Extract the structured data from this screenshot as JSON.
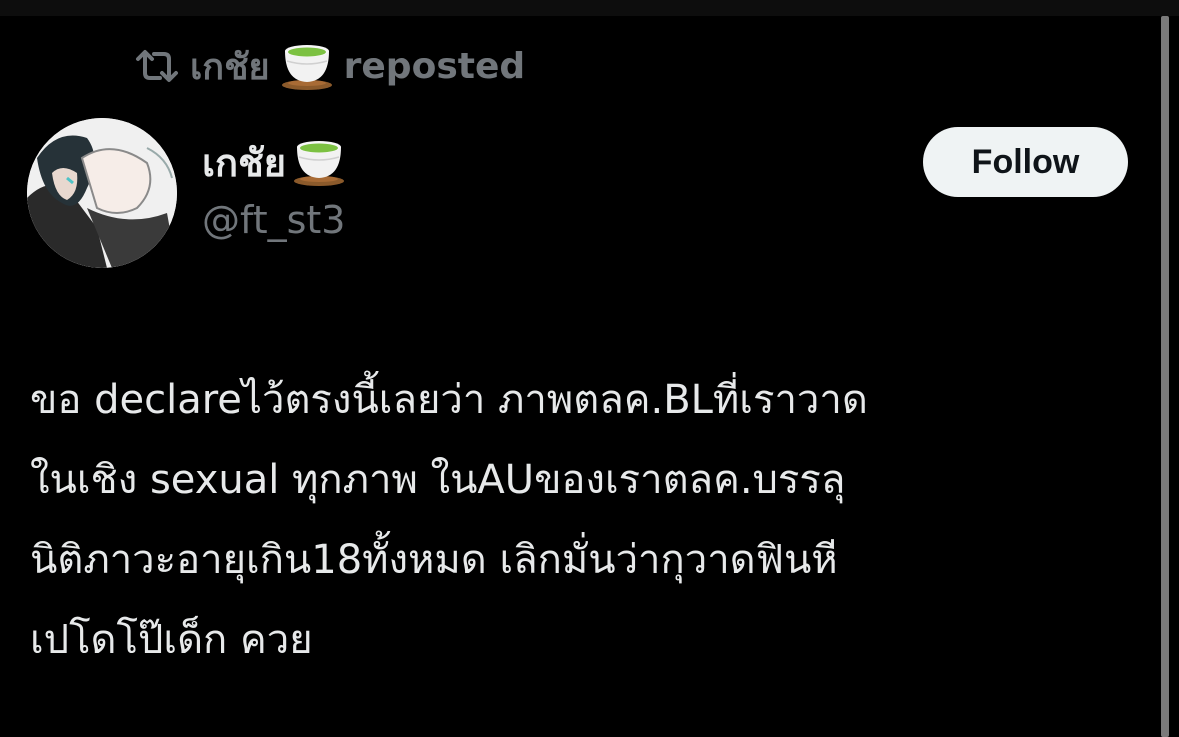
{
  "repost": {
    "icon": "repost-icon",
    "user": "เกชัย",
    "emoji": "🍵",
    "label": "reposted"
  },
  "author": {
    "display_name": "เกชัย",
    "emoji": "🍵",
    "handle": "@ft_st3",
    "avatar": "anime-character-avatar"
  },
  "follow_button": {
    "label": "Follow"
  },
  "tweet": {
    "lines": [
      "ขอ declareไว้ตรงนี้เลยว่า ภาพตลค.BLที่เราวาด",
      "ในเชิง sexual ทุกภาพ ในAUของเราตลค.บรรลุ",
      "นิติภาวะอายุเกิน18ทั้งหมด เลิกมั่นว่ากุวาดฟินหี",
      "เปโดโป๊เด็ก ควย"
    ]
  },
  "colors": {
    "background": "#000000",
    "primary_text": "#e7e9ea",
    "secondary_text": "#71767b",
    "follow_bg": "#eff3f4",
    "follow_text": "#0f1419"
  }
}
